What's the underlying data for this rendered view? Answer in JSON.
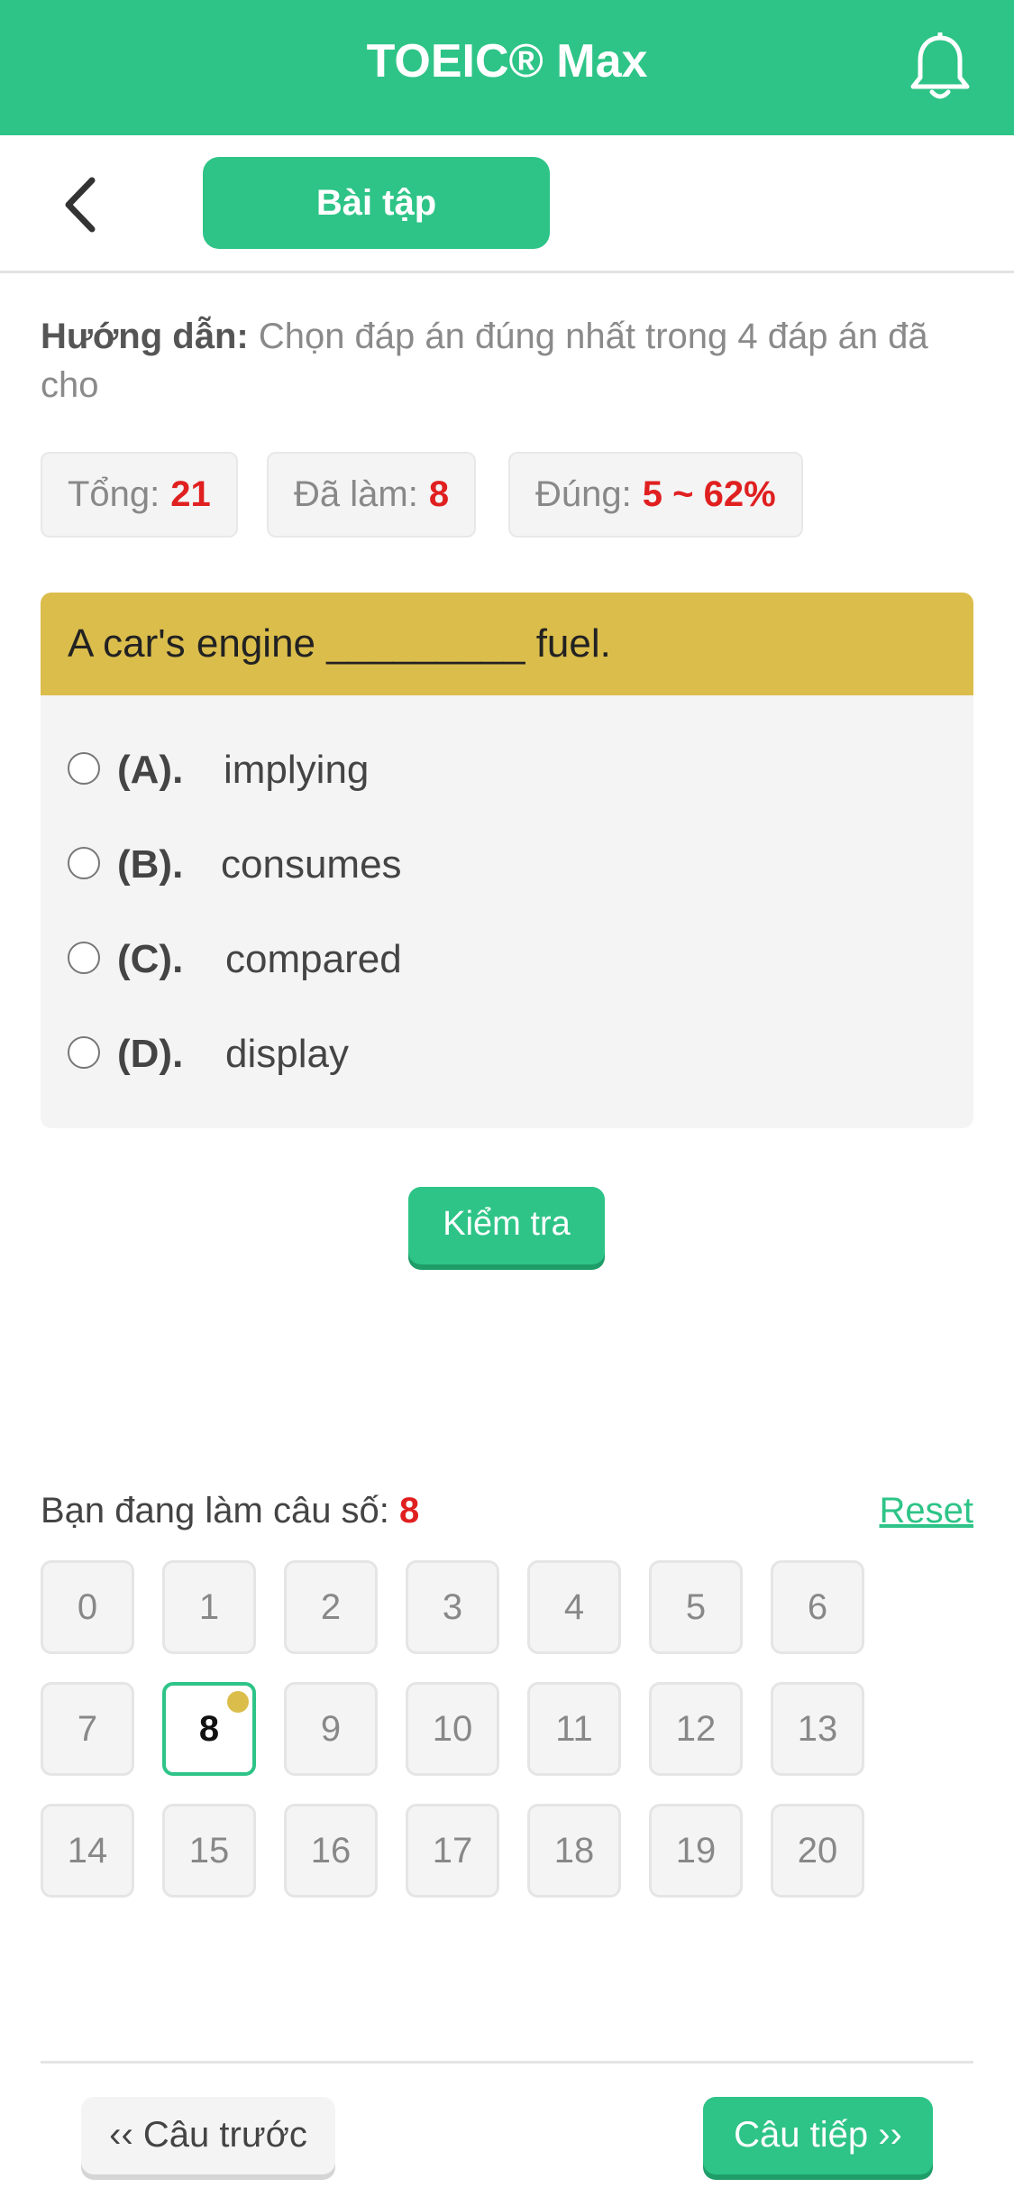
{
  "app": {
    "title": "TOEIC® Max"
  },
  "header": {
    "tab_label": "Bài tập"
  },
  "instructions": {
    "label": "Hướng dẫn:",
    "text": " Chọn đáp án đúng nhất trong 4 đáp án đã cho"
  },
  "stats": {
    "total_label": "Tổng:",
    "total_value": "21",
    "done_label": "Đã làm:",
    "done_value": "8",
    "correct_label": "Đúng:",
    "correct_value": "5 ~ 62%"
  },
  "question": {
    "text": "A car's engine _________ fuel.",
    "options": [
      {
        "key": "(A).",
        "text": "implying"
      },
      {
        "key": "(B).",
        "text": "consumes"
      },
      {
        "key": "(C).",
        "text": "compared"
      },
      {
        "key": "(D).",
        "text": "display"
      }
    ]
  },
  "check_button": "Kiểm tra",
  "progress": {
    "label": "Bạn đang làm câu số:",
    "current": "8",
    "reset_label": "Reset"
  },
  "question_numbers": [
    "0",
    "1",
    "2",
    "3",
    "4",
    "5",
    "6",
    "7",
    "8",
    "9",
    "10",
    "11",
    "12",
    "13",
    "14",
    "15",
    "16",
    "17",
    "18",
    "19",
    "20"
  ],
  "footer": {
    "prev_label": "‹‹ Câu trước",
    "next_label": "Câu tiếp ››"
  },
  "colors": {
    "primary": "#2ec487",
    "question_bg": "#dbbd4c",
    "accent_red": "#e02020"
  },
  "icons": {
    "notification": "bell-icon",
    "back": "chevron-left-icon"
  }
}
